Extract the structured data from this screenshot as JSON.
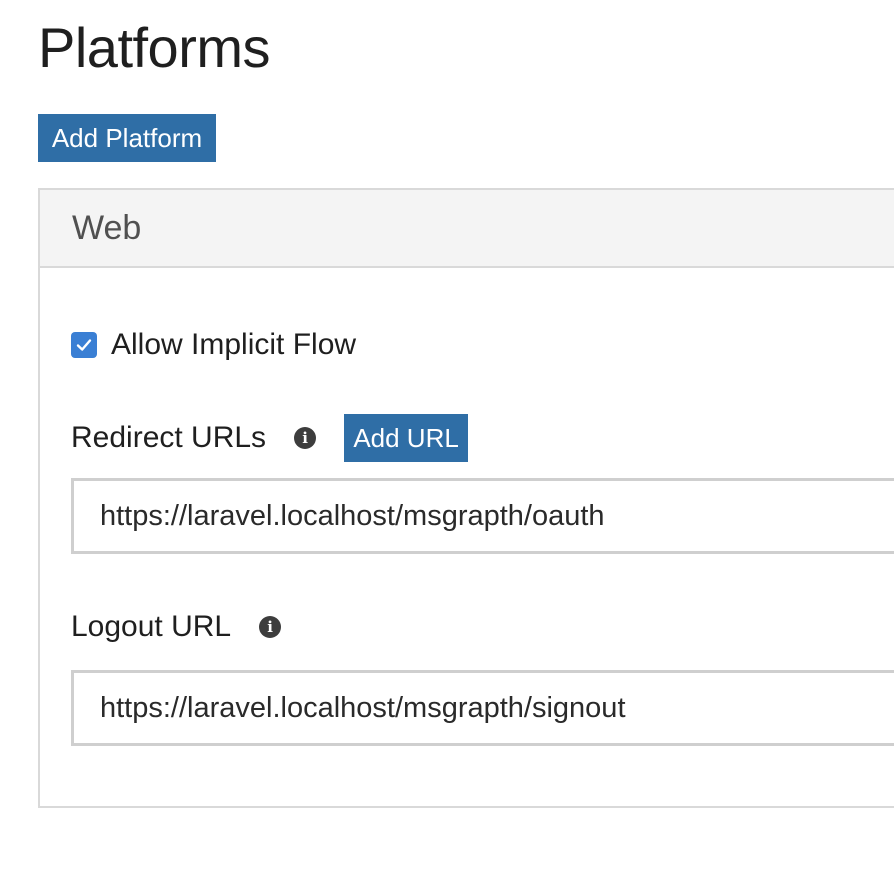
{
  "page": {
    "title": "Platforms"
  },
  "toolbar": {
    "add_platform_label": "Add Platform"
  },
  "platform": {
    "name": "Web",
    "allow_implicit_flow": {
      "label": "Allow Implicit Flow",
      "checked": true
    },
    "redirect_urls": {
      "label": "Redirect URLs",
      "add_url_label": "Add URL",
      "values": [
        "https://laravel.localhost/msgrapth/oauth"
      ]
    },
    "logout_url": {
      "label": "Logout URL",
      "value": "https://laravel.localhost/msgrapth/signout"
    }
  },
  "icons": {
    "info": "info-icon",
    "checkmark": "checkmark-icon"
  },
  "colors": {
    "primary_button": "#2f6ea6",
    "checkbox_checked": "#3a7fd4",
    "panel_header_bg": "#f4f4f4",
    "border": "#d9d9d9"
  }
}
